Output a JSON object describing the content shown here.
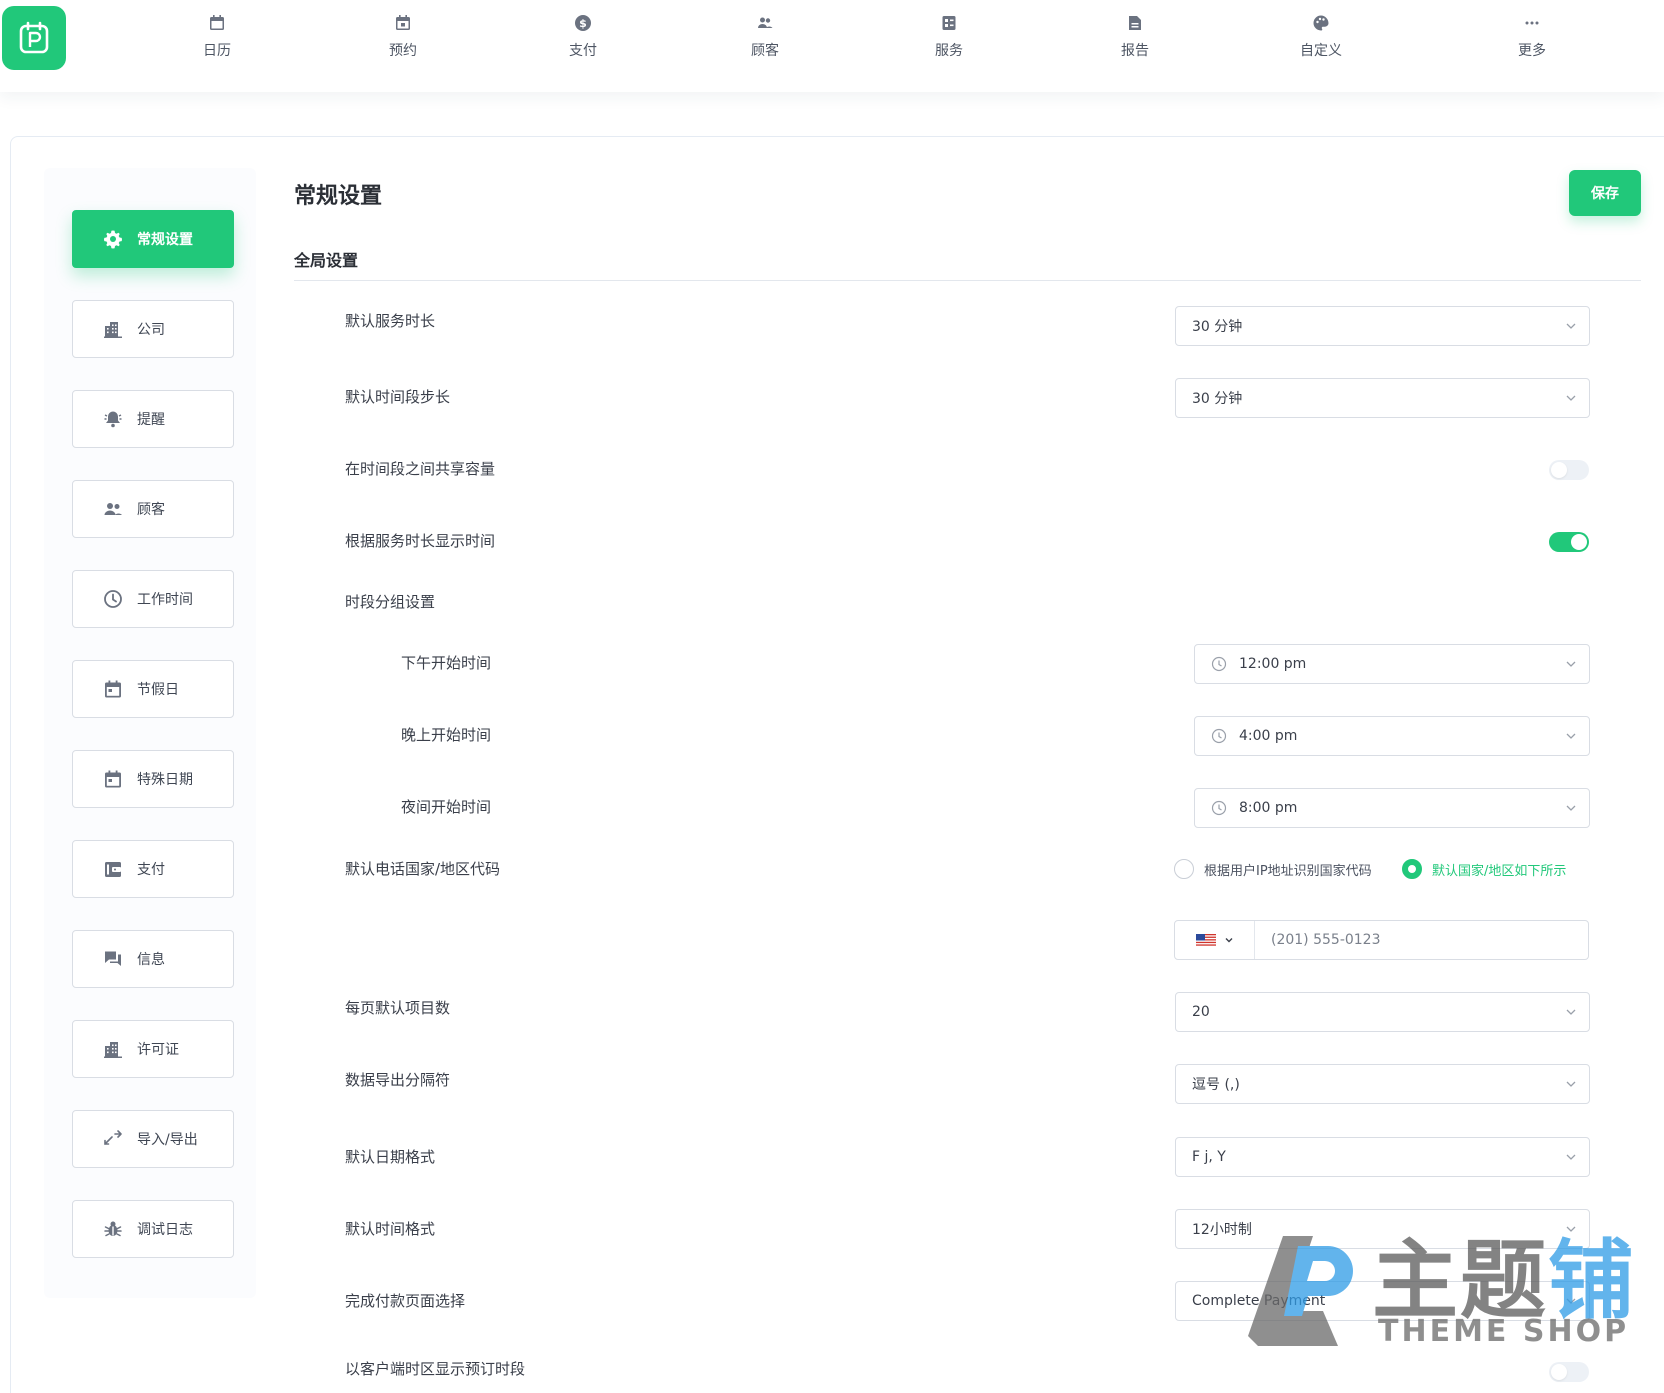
{
  "nav": {
    "items": [
      {
        "label": "日历",
        "icon": "calendar-icon"
      },
      {
        "label": "预约",
        "icon": "appointment-icon"
      },
      {
        "label": "支付",
        "icon": "dollar-icon"
      },
      {
        "label": "顾客",
        "icon": "customers-icon"
      },
      {
        "label": "服务",
        "icon": "services-icon"
      },
      {
        "label": "报告",
        "icon": "report-icon"
      },
      {
        "label": "自定义",
        "icon": "palette-icon"
      },
      {
        "label": "更多",
        "icon": "more-icon"
      }
    ]
  },
  "sidebar": {
    "items": [
      {
        "label": "常规设置",
        "icon": "gear-icon",
        "active": true
      },
      {
        "label": "公司",
        "icon": "building-icon"
      },
      {
        "label": "提醒",
        "icon": "bell-icon"
      },
      {
        "label": "顾客",
        "icon": "users-icon"
      },
      {
        "label": "工作时间",
        "icon": "clock-icon"
      },
      {
        "label": "节假日",
        "icon": "calendar-icon"
      },
      {
        "label": "特殊日期",
        "icon": "calendar-day-icon"
      },
      {
        "label": "支付",
        "icon": "wallet-icon"
      },
      {
        "label": "信息",
        "icon": "chat-icon"
      },
      {
        "label": "许可证",
        "icon": "building-icon"
      },
      {
        "label": "导入/导出",
        "icon": "import-export-icon"
      },
      {
        "label": "调试日志",
        "icon": "bug-icon"
      }
    ]
  },
  "main": {
    "title": "常规设置",
    "save_label": "保存",
    "section_title": "全局设置",
    "rows": {
      "service_duration": {
        "label": "默认服务时长",
        "value": "30 分钟"
      },
      "slot_step": {
        "label": "默认时间段步长",
        "value": "30 分钟"
      },
      "share_capacity": {
        "label": "在时间段之间共享容量",
        "enabled": false
      },
      "show_by_duration": {
        "label": "根据服务时长显示时间",
        "enabled": true
      },
      "slot_group": {
        "label": "时段分组设置"
      },
      "afternoon_start": {
        "label": "下午开始时间",
        "value": "12:00 pm"
      },
      "evening_start": {
        "label": "晚上开始时间",
        "value": "4:00 pm"
      },
      "night_start": {
        "label": "夜间开始时间",
        "value": "8:00 pm"
      },
      "phone_code": {
        "label": "默认电话国家/地区代码",
        "option_ip": "根据用户IP地址识别国家代码",
        "option_default": "默认国家/地区如下所示",
        "selected": "option_default",
        "placeholder": "(201) 555-0123"
      },
      "per_page": {
        "label": "每页默认项目数",
        "value": "20"
      },
      "export_delimiter": {
        "label": "数据导出分隔符",
        "value": "逗号 (,)"
      },
      "date_format": {
        "label": "默认日期格式",
        "value": "F j, Y"
      },
      "time_format": {
        "label": "默认时间格式",
        "value": "12小时制"
      },
      "payment_page": {
        "label": "完成付款页面选择",
        "value": "Complete Payment"
      },
      "client_timezone": {
        "label": "以客户端时区显示预订时段",
        "enabled": false
      }
    }
  },
  "watermark": {
    "cn_a": "主题",
    "cn_b": "铺",
    "en": "THEME SHOP"
  },
  "colors": {
    "accent": "#21c87a",
    "border": "#d9dde4",
    "text": "#3a3f4a",
    "watermark_blue": "#2e9be6"
  }
}
